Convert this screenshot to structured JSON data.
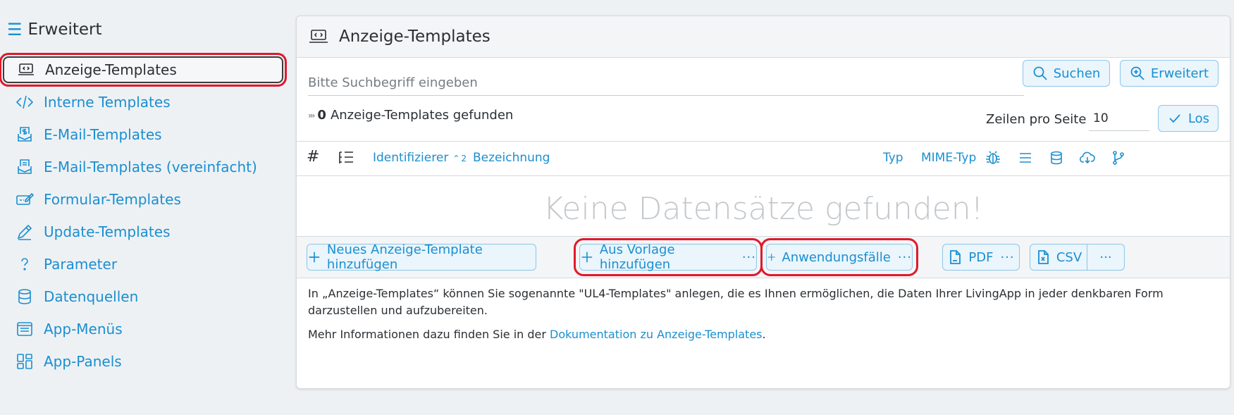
{
  "sidebar": {
    "heading": "Erweitert",
    "items": [
      {
        "label": "Anzeige-Templates"
      },
      {
        "label": "Interne Templates"
      },
      {
        "label": "E-Mail-Templates"
      },
      {
        "label": "E-Mail-Templates (vereinfacht)"
      },
      {
        "label": "Formular-Templates"
      },
      {
        "label": "Update-Templates"
      },
      {
        "label": "Parameter"
      },
      {
        "label": "Datenquellen"
      },
      {
        "label": "App-Menüs"
      },
      {
        "label": "App-Panels"
      }
    ]
  },
  "panel": {
    "title": "Anzeige-Templates",
    "search": {
      "placeholder": "Bitte Suchbegriff eingeben",
      "value": "",
      "search_label": "Suchen",
      "advanced_label": "Erweitert"
    },
    "results": {
      "count": "0",
      "label": "Anzeige-Templates gefunden"
    },
    "rows_per_page": {
      "label": "Zeilen pro Seite",
      "value": "10",
      "go_label": "Los"
    },
    "columns": {
      "hash": "#",
      "identifier": "Identifizierer",
      "identifier_sort": "2",
      "name": "Bezeichnung",
      "type": "Typ",
      "mime": "MIME-Typ"
    },
    "empty_message": "Keine Datensätze gefunden!",
    "actions": {
      "add_new": "Neues Anzeige-Template hinzufügen",
      "from_template": "Aus Vorlage hinzufügen",
      "use_cases": "Anwendungsfälle",
      "pdf": "PDF",
      "csv": "CSV",
      "more": "···",
      "dots": "···"
    },
    "info": {
      "text1": "In „Anzeige-Templates“ können Sie sogenannte \"UL4-Templates\" anlegen, die es Ihnen ermöglichen, die Daten Ihrer LivingApp in jeder denkbaren Form darzustellen und aufzubereiten.",
      "text2_prefix": "Mehr Informationen dazu finden Sie in der ",
      "link": "Dokumentation zu Anzeige-Templates",
      "text2_suffix": "."
    }
  }
}
